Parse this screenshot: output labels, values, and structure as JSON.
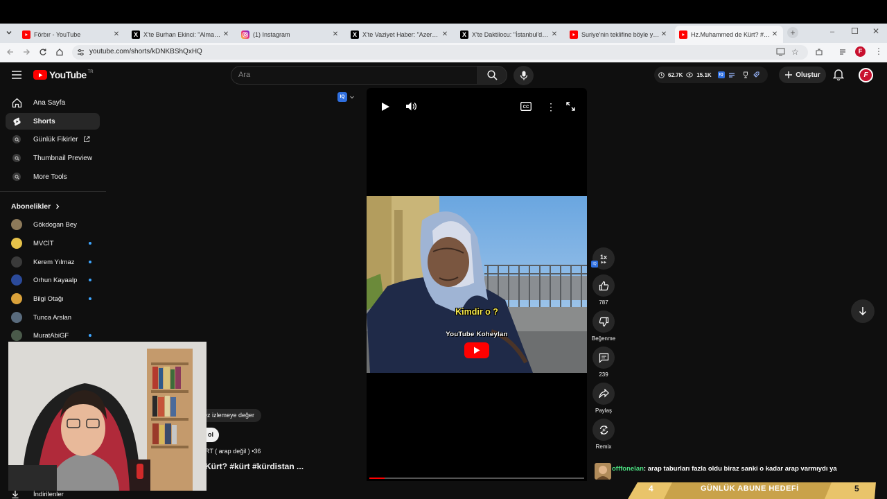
{
  "browser": {
    "tabs": [
      {
        "title": "Förbır - YouTube",
        "favicon": "youtube-icon",
        "active": false
      },
      {
        "title": "X'te Burhan Ekinci: \"Almanya K",
        "favicon": "x-icon",
        "active": false
      },
      {
        "title": "(1) Instagram",
        "favicon": "instagram-icon",
        "active": false
      },
      {
        "title": "X'te Vaziyet Haber: \"Azerbaycan",
        "favicon": "x-icon",
        "active": false
      },
      {
        "title": "X'te Daktilocu: \"İstanbul'da yaş",
        "favicon": "x-icon",
        "active": false
      },
      {
        "title": "Suriye'nin teklifine böyle yanıt",
        "favicon": "youtube-icon",
        "active": false
      },
      {
        "title": "Hz.Muhammed de Kürt? #kürt",
        "favicon": "youtube-icon",
        "active": true
      }
    ],
    "url": "youtube.com/shorts/kDNKBShQxHQ"
  },
  "header": {
    "logo_text": "YouTube",
    "logo_region": "TR",
    "search_placeholder": "Ara",
    "stats": {
      "views": "62.7K",
      "watch": "15.1K"
    },
    "create_label": "Oluştur"
  },
  "sidebar": {
    "items": [
      {
        "label": "Ana Sayfa",
        "icon": "home-icon"
      },
      {
        "label": "Shorts",
        "icon": "shorts-icon"
      },
      {
        "label": "Günlük Fikirler",
        "icon": "extension-icon"
      },
      {
        "label": "Thumbnail Preview",
        "icon": "extension-icon"
      },
      {
        "label": "More Tools",
        "icon": "extension-icon"
      }
    ],
    "subscriptions_title": "Abonelikler",
    "subscriptions": [
      {
        "label": "Gökdogan Bey",
        "color": "#8d7a5a",
        "dot": false
      },
      {
        "label": "MVCİT",
        "color": "#e6c24a",
        "dot": true
      },
      {
        "label": "Kerem Yılmaz",
        "color": "#3a3a3a",
        "dot": true
      },
      {
        "label": "Orhun Kayaalp",
        "color": "#2b4a9a",
        "dot": true
      },
      {
        "label": "Bilgi Otağı",
        "color": "#d9a13a",
        "dot": true
      },
      {
        "label": "Tunca Arslan",
        "color": "#596b7d",
        "dot": false
      },
      {
        "label": "MuratAbiGF",
        "color": "#4a5a4a",
        "dot": true
      }
    ],
    "downloads_label": "İndirilenler"
  },
  "short": {
    "overlay_text": "Kimdir o ?",
    "watermark": "YouTube Koheylan",
    "chip_text": "ez izlemeye değer",
    "subscribe_partial": "ol",
    "channel_line": "RT ( arap değil ) •36",
    "title_partial": "Kürt?  #kürt #kürdistan ...",
    "speed": "1x",
    "likes": "787",
    "dislike_label": "Beğenme",
    "comments": "239",
    "share_label": "Paylaş",
    "remix_label": "Remix"
  },
  "stream": {
    "chat_user": "offfonelan",
    "chat_message": ": arap taburları fazla oldu biraz sanki o kadar arap varmıydı ya",
    "goal_current": "4",
    "goal_label": "GÜNLÜK ABUNE HEDEFİ",
    "goal_target": "5"
  },
  "colors": {
    "youtube_red": "#ff0000",
    "accent_blue": "#3ea6ff",
    "goal_gold": "#e9c46a",
    "chat_user": "#4ade80"
  }
}
